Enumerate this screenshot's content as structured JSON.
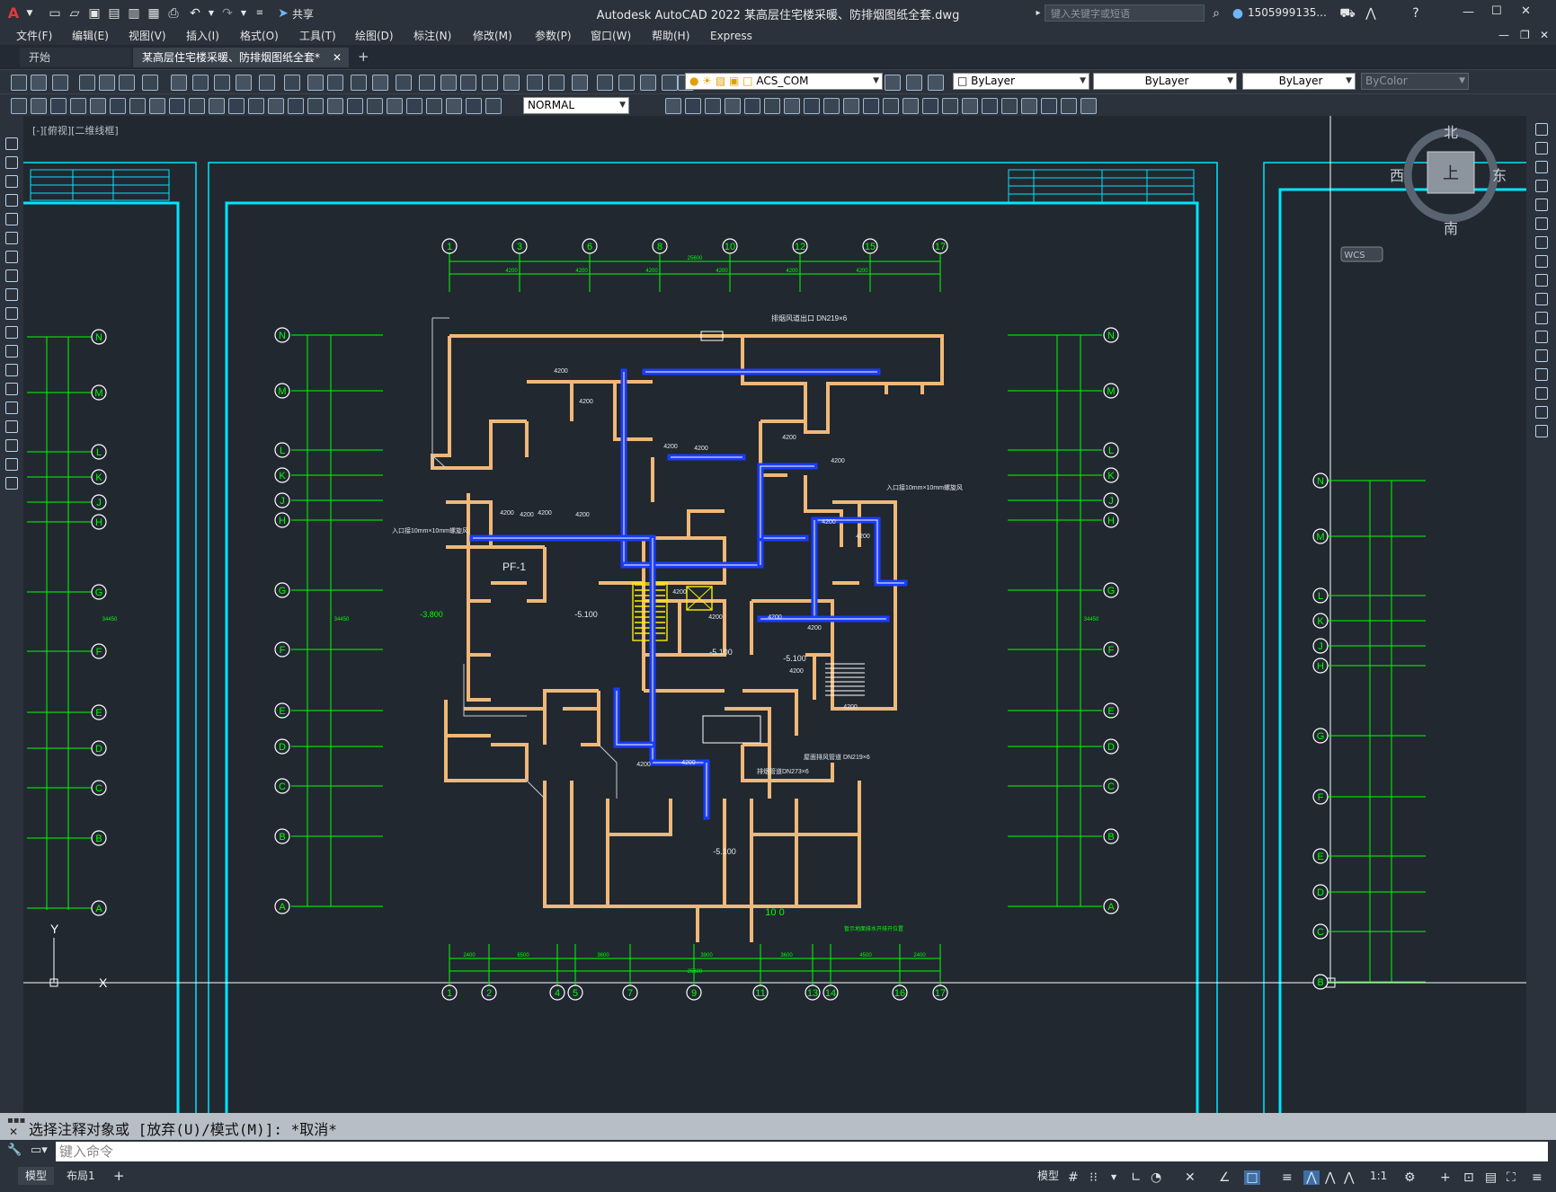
{
  "titlebar": {
    "app_logo": "A",
    "title": "Autodesk AutoCAD 2022    某高层住宅楼采暖、防排烟图纸全套.dwg",
    "share_label": "共享",
    "search_placeholder": "键入关键字或短语",
    "user_name": "1505999135..."
  },
  "menu": [
    "文件(F)",
    "编辑(E)",
    "视图(V)",
    "插入(I)",
    "格式(O)",
    "工具(T)",
    "绘图(D)",
    "标注(N)",
    "修改(M)",
    "参数(P)",
    "窗口(W)",
    "帮助(H)",
    "Express"
  ],
  "tabs": {
    "start": "开始",
    "active": "某高层住宅楼采暖、防排烟图纸全套*",
    "add": "+"
  },
  "toolbar1": {
    "layer_name": "ACS_COM",
    "color": "ByLayer",
    "linetype": "ByLayer",
    "lineweight": "ByLayer",
    "plotstyle": "ByColor"
  },
  "toolbar2": {
    "dimstyle": "NORMAL"
  },
  "canvas": {
    "view_label": "[-][俯视][二维线框]",
    "viewcube": {
      "north": "北",
      "south": "南",
      "east": "东",
      "west": "西",
      "top": "上",
      "wcs": "WCS"
    },
    "ucs": {
      "x": "X",
      "y": "Y"
    },
    "colors": {
      "background": "#212830",
      "frame": "#00e5ff",
      "grid": "#00ff00",
      "walls": "#f0b878",
      "duct": "#1a3cff",
      "text": "#e8eaee"
    },
    "top_axes": [
      "1",
      "3",
      "6",
      "8",
      "10",
      "12",
      "15",
      "17"
    ],
    "bottom_axes": [
      "1",
      "2",
      "4",
      "5",
      "7",
      "9",
      "11",
      "13",
      "14",
      "16",
      "17"
    ],
    "left_axes": [
      "N",
      "M",
      "L",
      "K",
      "J",
      "H",
      "G",
      "F",
      "E",
      "D",
      "C",
      "B",
      "A"
    ],
    "right_axes": [
      "N",
      "M",
      "L",
      "K",
      "J",
      "H",
      "G",
      "F",
      "E",
      "D",
      "C",
      "B",
      "A"
    ],
    "overall_dim": "25600",
    "side_dim": "34450",
    "top_dims": [
      "4200",
      "4200",
      "4200",
      "4200",
      "4200",
      "4200"
    ],
    "bottom_dims": [
      "2400",
      "6500",
      "3600",
      "3900",
      "3600",
      "4500",
      "2400"
    ],
    "labels": {
      "elev1": "-3.800",
      "elev2": "-5.100",
      "elev3": "-5.100",
      "elev4": "-5.100",
      "elev5": "-5.100",
      "pf": "PF-1",
      "dn1": "排烟风道出口 DN219×6",
      "dn2": "入口接10mm×10mm螺旋风",
      "dn3": "入口接10mm×10mm螺旋风",
      "dn4": "排烟管道DN273×6",
      "dn5": "屋面排风管道 DN219×6",
      "qty1": "10 0",
      "note1": "暂示地面排水开排开位置"
    }
  },
  "command": {
    "history": "选择注释对象或 [放弃(U)/模式(M)]: *取消*",
    "placeholder": "键入命令"
  },
  "status": {
    "model_tab": "模型",
    "layout_tab": "布局1",
    "add": "+",
    "model_label": "模型",
    "scale": "1:1"
  }
}
